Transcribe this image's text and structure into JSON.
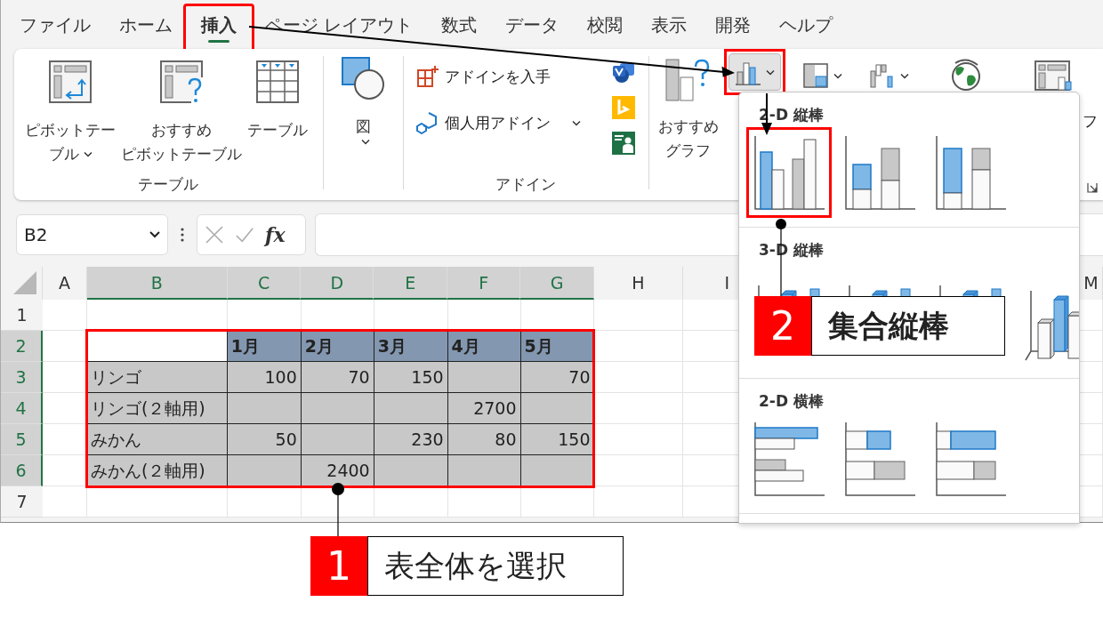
{
  "tabs": [
    {
      "label": "ファイル",
      "selected": false,
      "highlighted": false
    },
    {
      "label": "ホーム",
      "selected": false,
      "highlighted": false
    },
    {
      "label": "挿入",
      "selected": true,
      "highlighted": true
    },
    {
      "label": "ページ レイアウト",
      "selected": false,
      "highlighted": false
    },
    {
      "label": "数式",
      "selected": false,
      "highlighted": false
    },
    {
      "label": "データ",
      "selected": false,
      "highlighted": false
    },
    {
      "label": "校閲",
      "selected": false,
      "highlighted": false
    },
    {
      "label": "表示",
      "selected": false,
      "highlighted": false
    },
    {
      "label": "開発",
      "selected": false,
      "highlighted": false
    },
    {
      "label": "ヘルプ",
      "selected": false,
      "highlighted": false
    }
  ],
  "ribbon": {
    "table_group": {
      "label": "テーブル",
      "buttons": [
        {
          "kind": "pivot",
          "lines": [
            "ピボットテー",
            "ブル"
          ],
          "caret": true
        },
        {
          "kind": "recommended-pivot",
          "lines": [
            "おすすめ",
            "ピボットテーブル"
          ],
          "caret": false
        },
        {
          "kind": "table",
          "lines": [
            "テーブル"
          ],
          "caret": false
        }
      ]
    },
    "shapes_button": {
      "label": "図",
      "caret": true
    },
    "addin_group": {
      "label": "アドイン",
      "items": [
        {
          "kind": "get",
          "label": "アドインを入手",
          "caret": false
        },
        {
          "kind": "personal",
          "label": "個人用アドイン",
          "caret": true
        }
      ]
    },
    "recommended_chart": {
      "lines": [
        "おすすめ",
        "グラフ"
      ]
    },
    "chart_buttons": [
      {
        "kind": "column",
        "caret": true,
        "pressed": true,
        "highlighted": true
      },
      {
        "kind": "hierarchy",
        "caret": true,
        "pressed": false,
        "highlighted": false
      },
      {
        "kind": "waterfall",
        "caret": true,
        "pressed": false,
        "highlighted": false
      },
      {
        "kind": "map",
        "caret": false,
        "pressed": false,
        "highlighted": false
      },
      {
        "kind": "pivot-chart",
        "caret": false,
        "pressed": false,
        "highlighted": false
      }
    ],
    "cut_label": "フ"
  },
  "formula_bar": {
    "name_box": "B2",
    "fx": "fx"
  },
  "columns": [
    {
      "label": "A",
      "selected": false
    },
    {
      "label": "B",
      "selected": true
    },
    {
      "label": "C",
      "selected": true
    },
    {
      "label": "D",
      "selected": true
    },
    {
      "label": "E",
      "selected": true
    },
    {
      "label": "F",
      "selected": true
    },
    {
      "label": "G",
      "selected": true
    },
    {
      "label": "H",
      "selected": false
    },
    {
      "label": "I",
      "selected": false
    },
    {
      "label": "M",
      "selected": false
    }
  ],
  "rows": [
    {
      "number": "1",
      "selected": false,
      "kind": "empty"
    },
    {
      "number": "2",
      "selected": true,
      "kind": "header",
      "cells": [
        null,
        "1月",
        "2月",
        "3月",
        "4月",
        "5月"
      ]
    },
    {
      "number": "3",
      "selected": true,
      "kind": "data",
      "cells": [
        "リンゴ",
        "100",
        "70",
        "150",
        null,
        "70"
      ]
    },
    {
      "number": "4",
      "selected": true,
      "kind": "data",
      "cells": [
        "リンゴ(２軸用)",
        null,
        null,
        null,
        "2700",
        null
      ]
    },
    {
      "number": "5",
      "selected": true,
      "kind": "data",
      "cells": [
        "みかん",
        "50",
        null,
        "230",
        "80",
        "150"
      ]
    },
    {
      "number": "6",
      "selected": true,
      "kind": "data",
      "cells": [
        "みかん(２軸用)",
        null,
        "2400",
        null,
        null,
        null
      ]
    },
    {
      "number": "7",
      "selected": false,
      "kind": "empty"
    }
  ],
  "chart_gallery": {
    "sections": [
      {
        "title": "2-D 縦棒",
        "icons": [
          {
            "kind": "clustered",
            "highlighted": true
          },
          {
            "kind": "stacked",
            "highlighted": false
          },
          {
            "kind": "stacked100",
            "highlighted": false
          }
        ]
      },
      {
        "title": "3-D 縦棒",
        "icons": [
          {
            "kind": "clustered3d",
            "highlighted": false
          },
          {
            "kind": "stacked3d",
            "highlighted": false
          },
          {
            "kind": "full3d",
            "highlighted": false
          },
          {
            "kind": "column3d",
            "highlighted": false
          }
        ]
      },
      {
        "title": "2-D 横棒",
        "icons": [
          {
            "kind": "barclustered",
            "highlighted": false
          },
          {
            "kind": "barstacked",
            "highlighted": false
          },
          {
            "kind": "barfull",
            "highlighted": false
          }
        ]
      }
    ]
  },
  "callouts": [
    {
      "number": "1",
      "text": "表全体を選択"
    },
    {
      "number": "2",
      "text": "集合縦棒"
    }
  ]
}
